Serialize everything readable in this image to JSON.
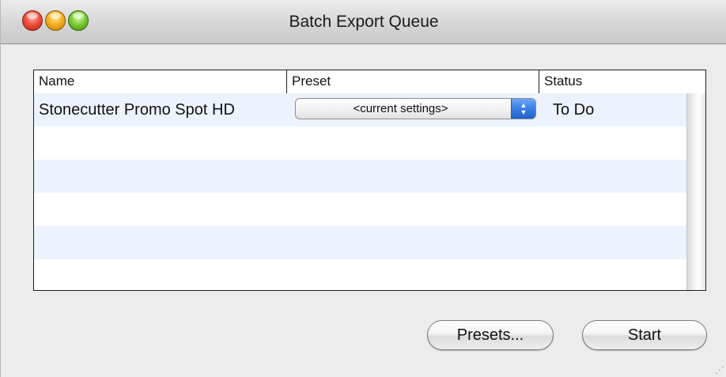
{
  "window": {
    "title": "Batch Export Queue",
    "controls": [
      "close",
      "minimize",
      "zoom"
    ]
  },
  "table": {
    "columns": [
      "Name",
      "Preset",
      "Status"
    ],
    "rows": [
      {
        "name": "Stonecutter Promo Spot HD",
        "preset": "<current settings>",
        "status": "To Do"
      }
    ]
  },
  "buttons": {
    "presets": "Presets...",
    "start": "Start"
  },
  "icons": {
    "popup_arrows": "up-down-chevron-icon",
    "resize": "resize-grip-icon"
  },
  "colors": {
    "row_alt": "#edf3fe",
    "popup_accent": "#3a7fe6",
    "window_bg": "#ececec"
  }
}
